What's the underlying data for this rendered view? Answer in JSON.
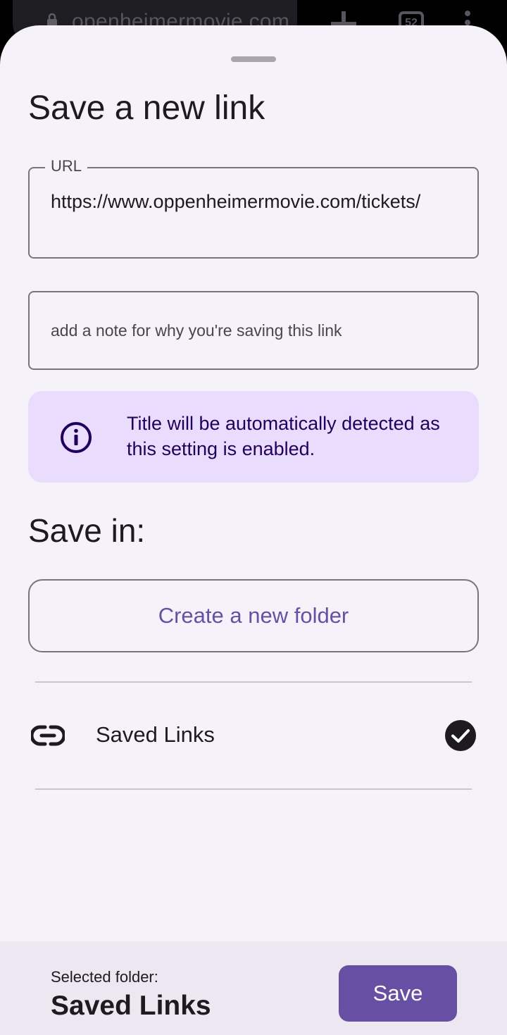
{
  "browser": {
    "url_text": "openheimermovie.com",
    "tab_count": "52"
  },
  "sheet": {
    "title": "Save a new link",
    "url_field": {
      "label": "URL",
      "value": "https://www.oppenheimermovie.com/tickets/"
    },
    "note_field": {
      "placeholder": "add a note for why you're saving this link",
      "value": ""
    },
    "info_card": {
      "icon": "info-icon",
      "text": "Title will be automatically detected as this setting is enabled."
    },
    "save_in": {
      "heading": "Save in:",
      "create_folder_label": "Create a new folder",
      "folders": [
        {
          "name": "Saved Links",
          "icon": "link-icon",
          "selected": true
        }
      ]
    },
    "footer": {
      "selected_label": "Selected folder:",
      "selected_value": "Saved Links",
      "save_label": "Save"
    }
  },
  "colors": {
    "accent": "#6750a4",
    "sheet_background": "#f6f2f9",
    "info_background": "#eadcfc",
    "info_text": "#21005d",
    "outline": "#79747e",
    "divider": "#cac4d0",
    "footer_background": "#ede7f2"
  }
}
